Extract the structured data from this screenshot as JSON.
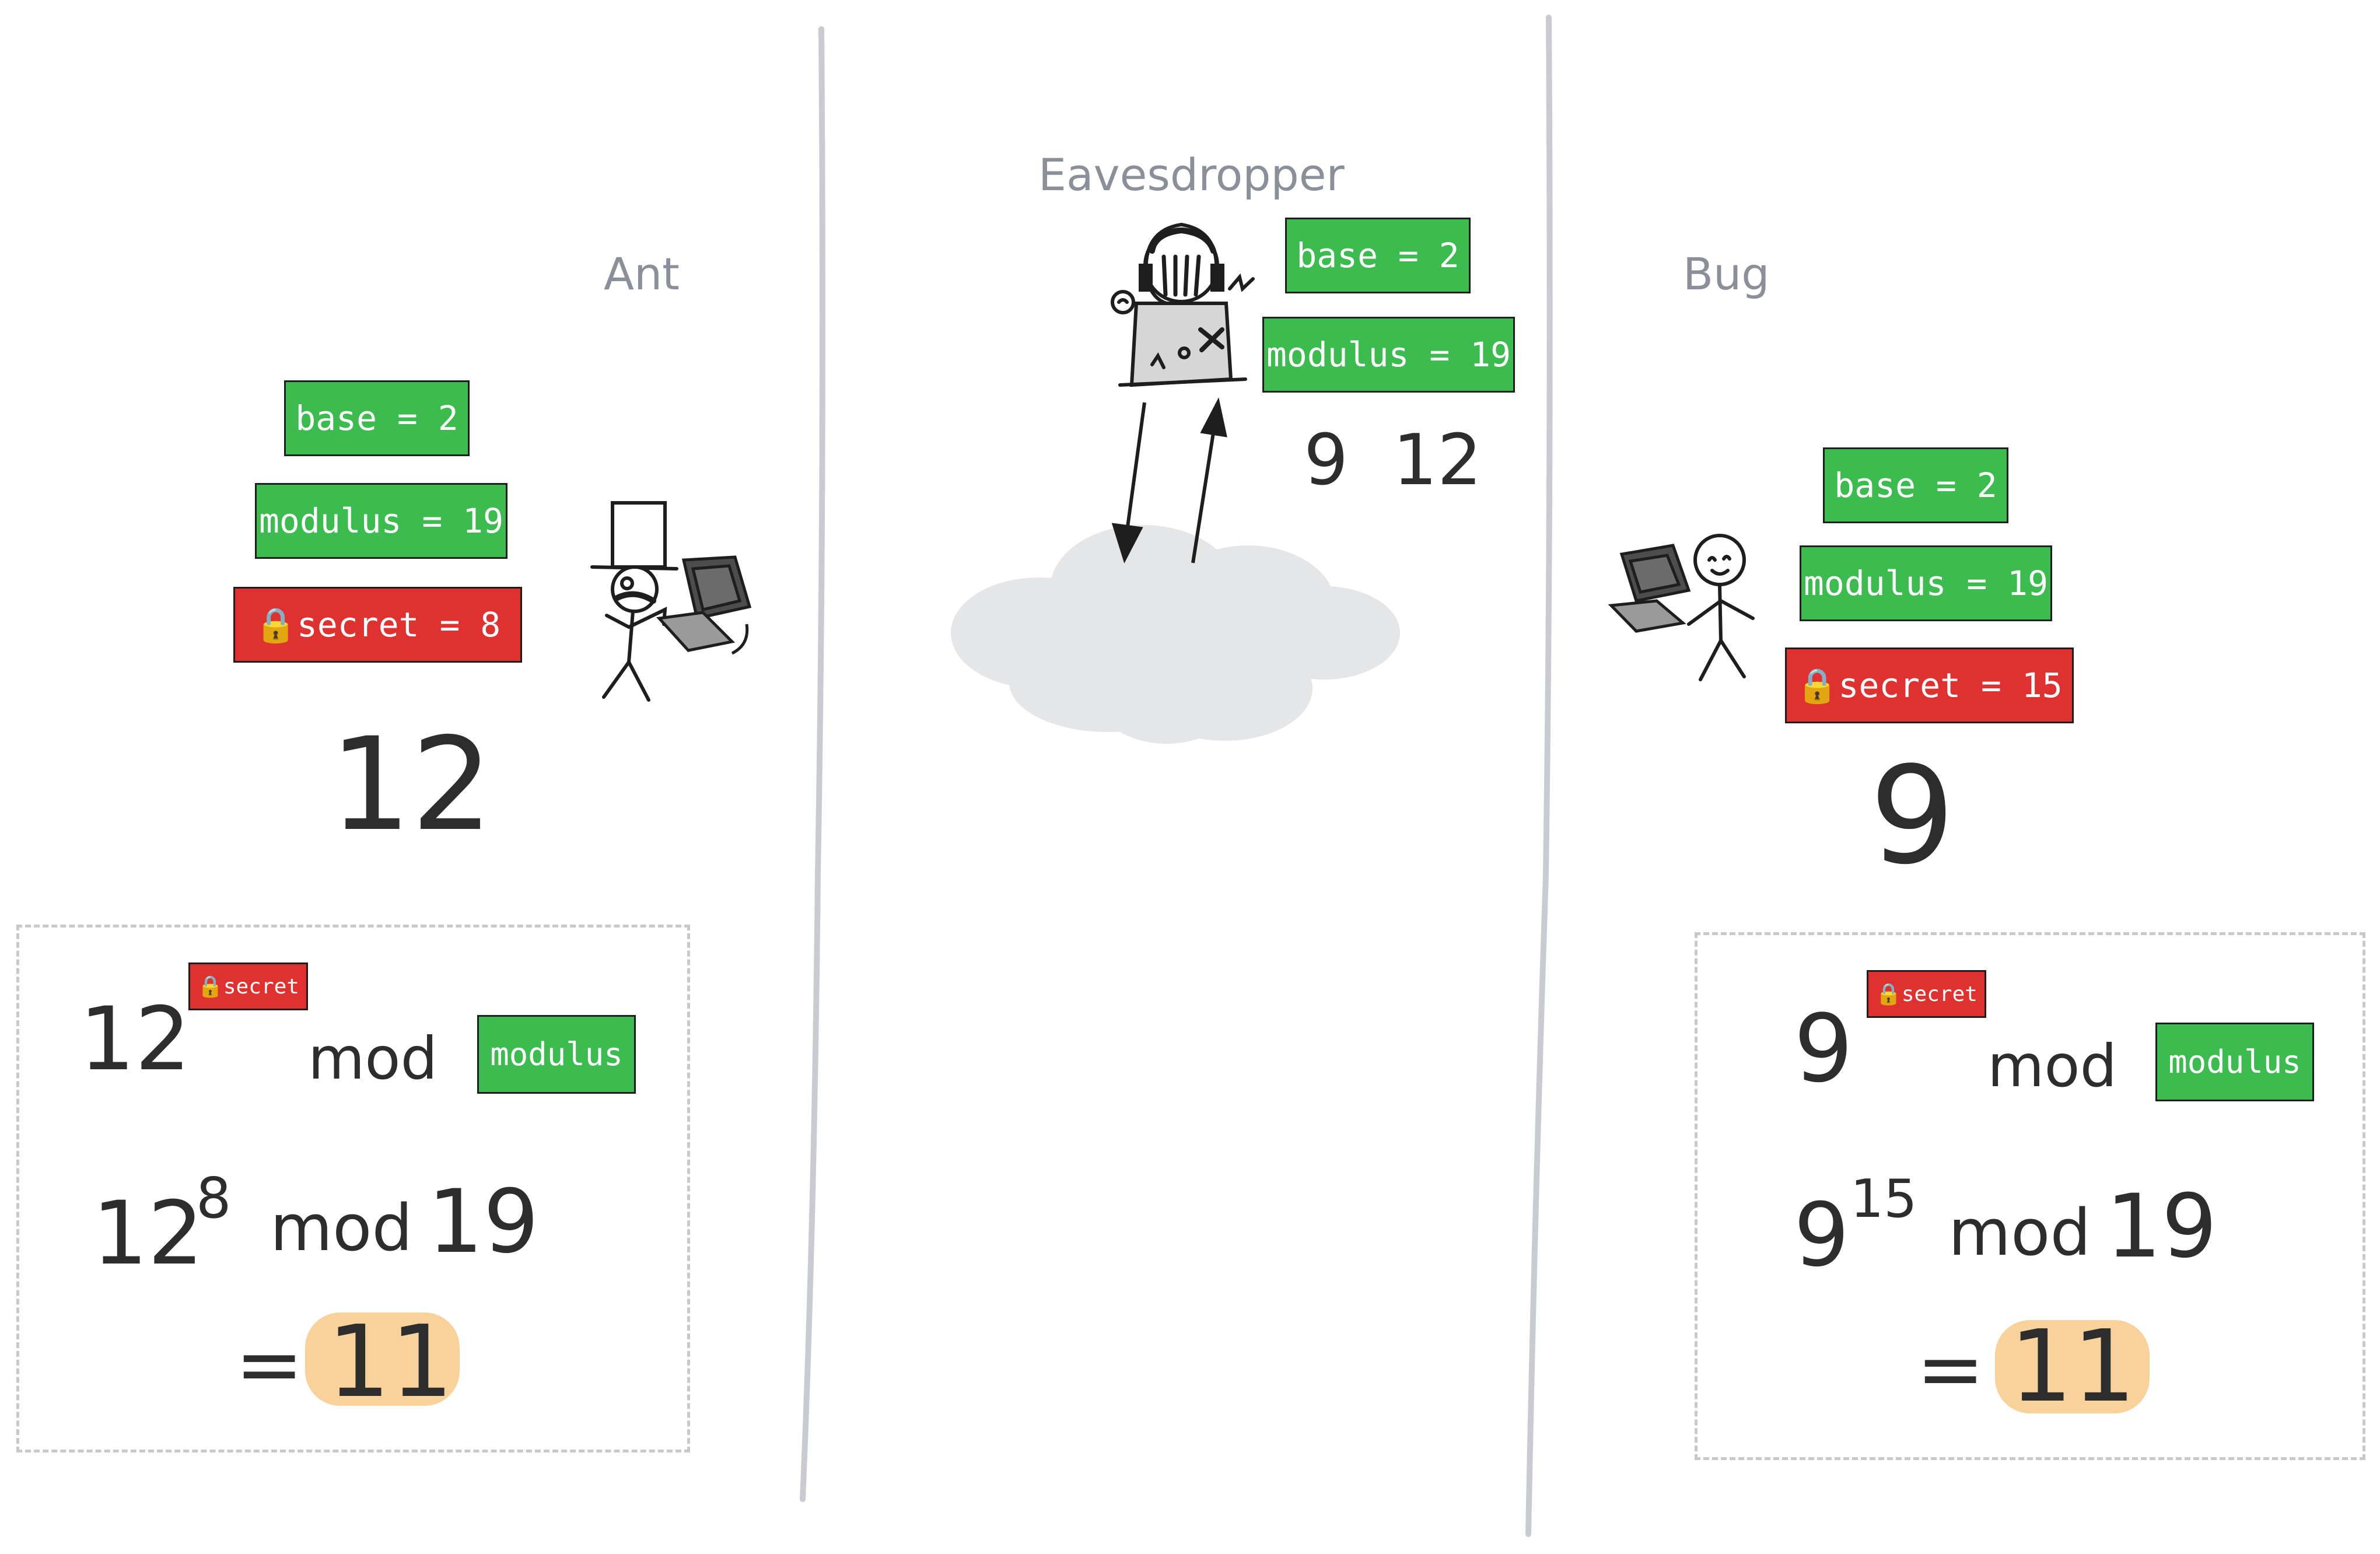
{
  "ant": {
    "name": "Ant",
    "base_tag": "base = 2",
    "modulus_tag": "modulus = 19",
    "secret_tag": "🔒secret = 8",
    "public_value": "12",
    "formula": {
      "base": "12",
      "secret_label": "🔒secret",
      "mod": "mod",
      "modulus_label": "modulus",
      "line2_base": "12",
      "line2_exp": "8",
      "line2_mod": "mod",
      "line2_modulus": "19",
      "equals": "=",
      "result": "11"
    }
  },
  "eavesdropper": {
    "name": "Eavesdropper",
    "base_tag": "base = 2",
    "modulus_tag": "modulus = 19",
    "intercepted": "9  12"
  },
  "bug": {
    "name": "Bug",
    "base_tag": "base = 2",
    "modulus_tag": "modulus = 19",
    "secret_tag": "🔒secret = 15",
    "public_value": "9",
    "formula": {
      "base": "9",
      "secret_label": "🔒secret",
      "mod": "mod",
      "modulus_label": "modulus",
      "line2_base": "9",
      "line2_exp": "15",
      "line2_mod": "mod",
      "line2_modulus": "19",
      "equals": "=",
      "result": "11"
    }
  },
  "colors": {
    "green": "#3cbc4e",
    "red": "#e03131",
    "highlight": "#f7c98a",
    "divider": "#c8ccd2",
    "cloud": "#e4e6e8"
  },
  "icons": [
    "top-hat-stick-figure-icon",
    "computer-icon",
    "headset-hacker-icon",
    "stick-figure-icon",
    "cloud-icon"
  ]
}
